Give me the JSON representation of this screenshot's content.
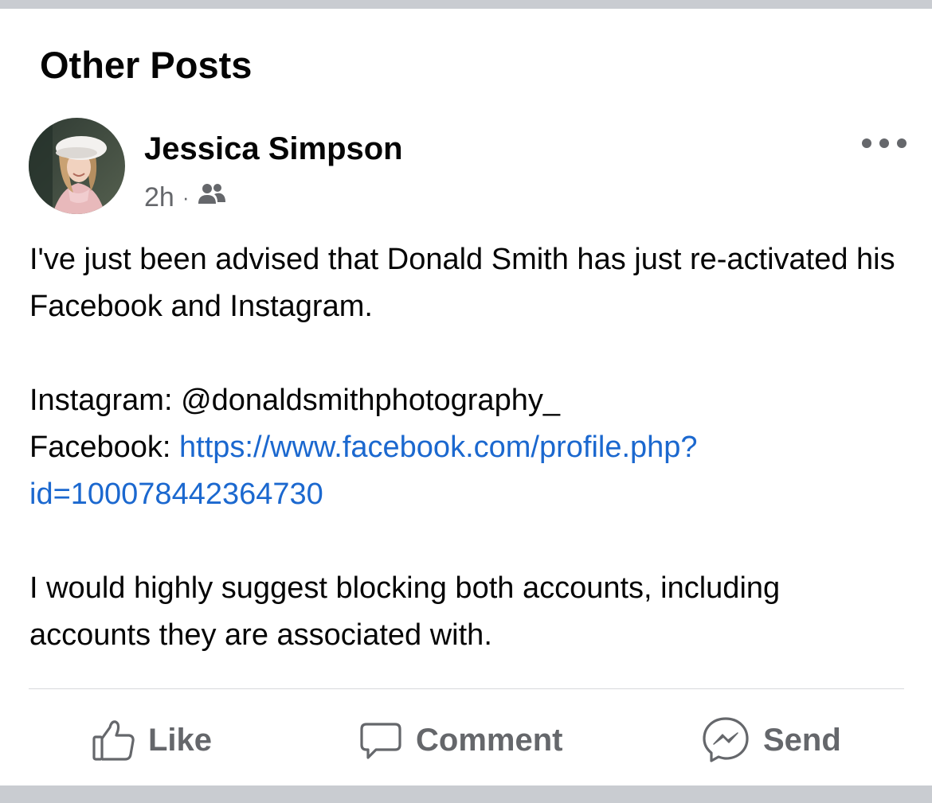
{
  "section": {
    "title": "Other Posts"
  },
  "post": {
    "author": "Jessica Simpson",
    "time": "2h",
    "separator": "·",
    "audience_icon": "friends-icon",
    "more_icon": "more-options-icon",
    "body": {
      "paragraph1": "I've just been advised that Donald Smith has just re-activated his Facebook and Instagram.",
      "instagram_label": "Instagram: ",
      "instagram_handle": "@donaldsmithphotography_",
      "facebook_label": "Facebook: ",
      "facebook_link": "https://www.facebook.com/profile.php?id=100078442364730",
      "paragraph3": "I would highly suggest blocking both accounts, including accounts they are associated with."
    },
    "link_color": "#1b68cf"
  },
  "actions": {
    "like": {
      "label": "Like",
      "icon": "thumbs-up-icon"
    },
    "comment": {
      "label": "Comment",
      "icon": "comment-icon"
    },
    "send": {
      "label": "Send",
      "icon": "messenger-icon"
    }
  }
}
